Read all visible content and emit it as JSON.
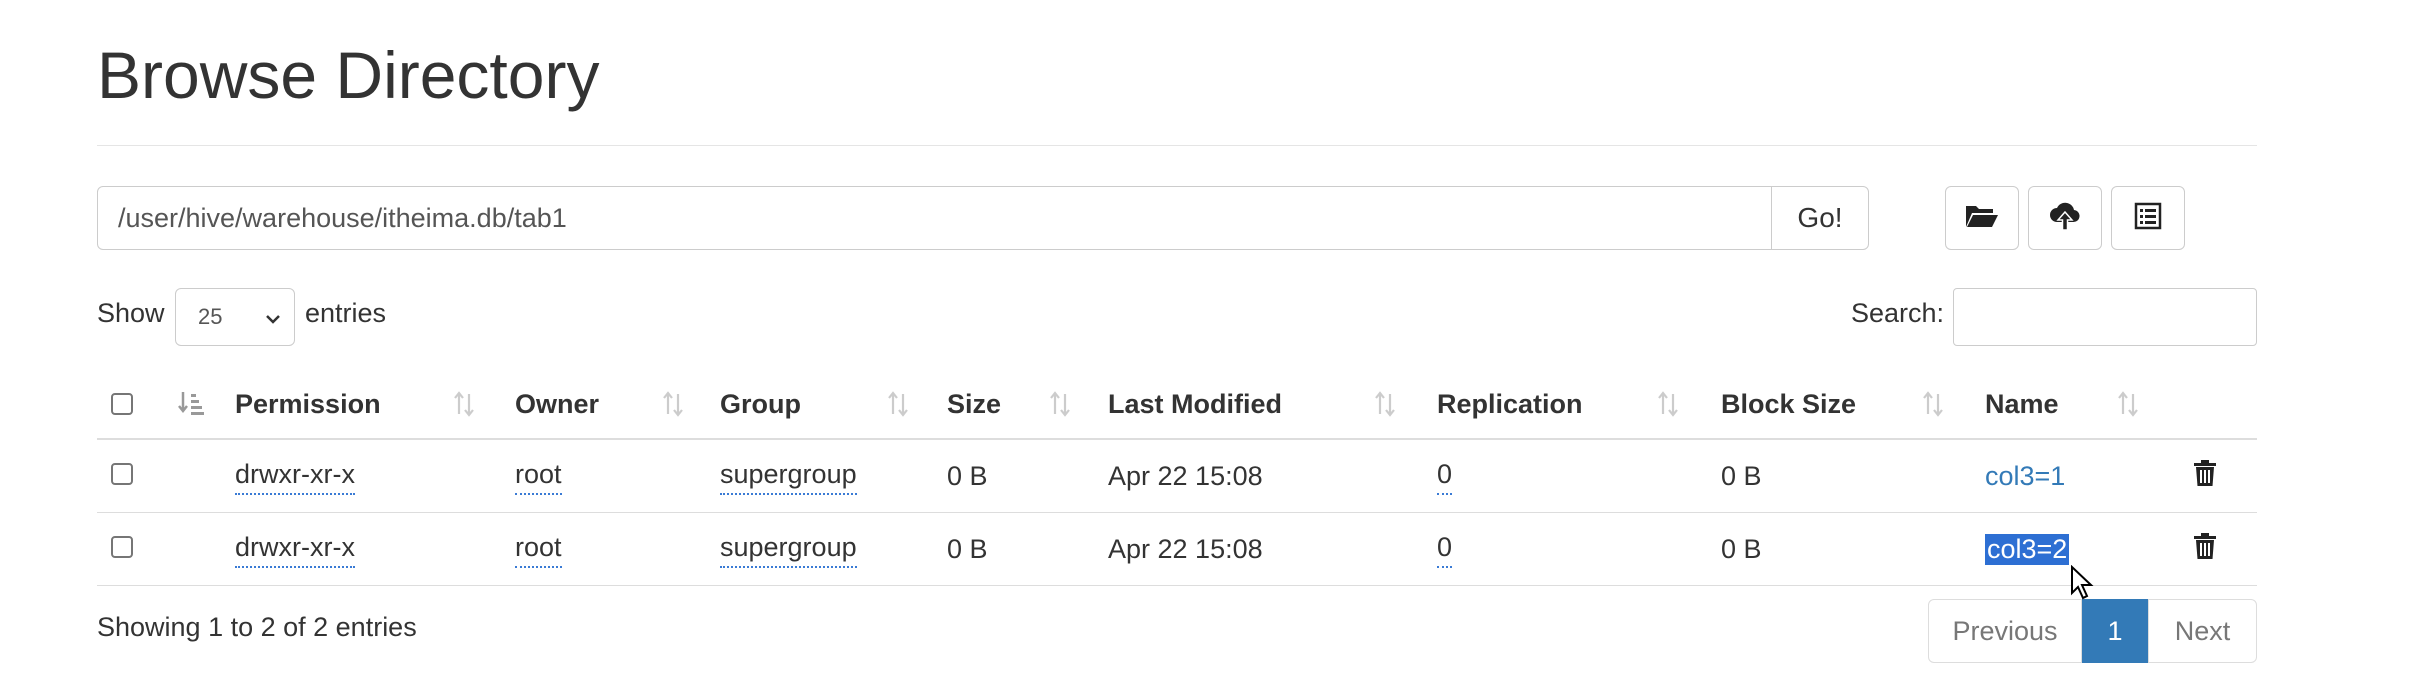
{
  "page": {
    "title": "Browse Directory"
  },
  "path": {
    "value": "/user/hive/warehouse/itheima.db/tab1",
    "go_label": "Go!"
  },
  "toolbar": {
    "icons": [
      "folder-open-icon",
      "cloud-upload-icon",
      "list-alt-icon"
    ]
  },
  "length": {
    "show_label": "Show",
    "selected": "25",
    "entries_label": "entries"
  },
  "search": {
    "label": "Search:",
    "value": ""
  },
  "table": {
    "columns": [
      "Permission",
      "Owner",
      "Group",
      "Size",
      "Last Modified",
      "Replication",
      "Block Size",
      "Name"
    ],
    "rows": [
      {
        "permission": "drwxr-xr-x",
        "owner": "root",
        "group": "supergroup",
        "size": "0 B",
        "modified": "Apr 22 15:08",
        "replication": "0",
        "block_size": "0 B",
        "name": "col3=1"
      },
      {
        "permission": "drwxr-xr-x",
        "owner": "root",
        "group": "supergroup",
        "size": "0 B",
        "modified": "Apr 22 15:08",
        "replication": "0",
        "block_size": "0 B",
        "name": "col3=2"
      }
    ]
  },
  "footer": {
    "info": "Showing 1 to 2 of 2 entries"
  },
  "pagination": {
    "previous": "Previous",
    "current": "1",
    "next": "Next"
  },
  "colors": {
    "link": "#337ab7",
    "pager_active": "#337ab7",
    "selection": "#2d6fd3"
  }
}
